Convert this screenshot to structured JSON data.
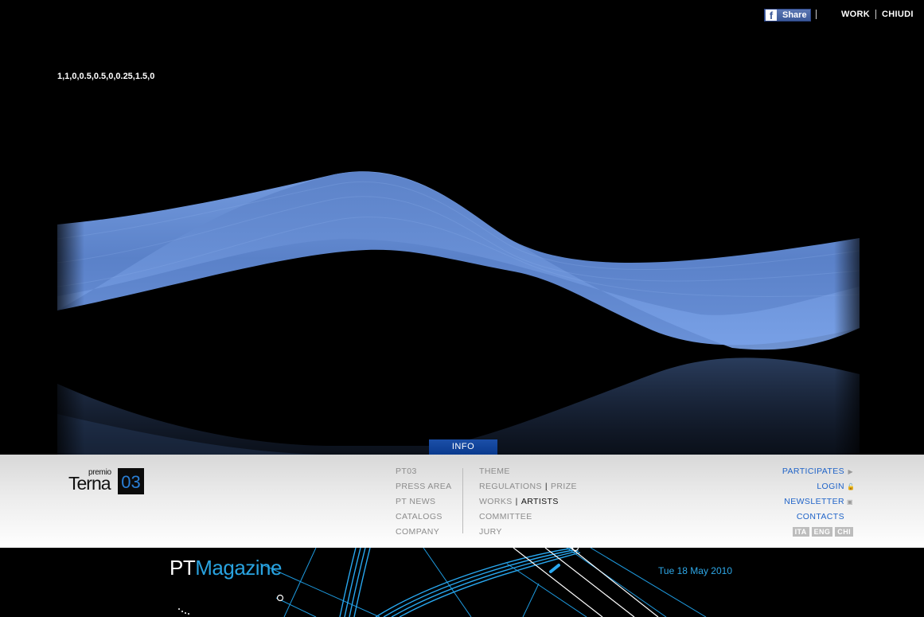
{
  "topbar": {
    "share_label": "Share",
    "fb_glyph": "f",
    "work_label": "WORK",
    "close_label": "CHIUDI"
  },
  "artwork": {
    "params_text": "1,1,0,0.5,0.5,0,0.25,1.5,0",
    "ribbon_color": "#6a92d8"
  },
  "info_tab": {
    "label": "INFO"
  },
  "logo": {
    "premio": "premio",
    "terna": "Terna",
    "number": "03"
  },
  "nav": {
    "col1": [
      "PT03",
      "PRESS AREA",
      "PT NEWS",
      "CATALOGS",
      "COMPANY"
    ],
    "col2": {
      "theme": "THEME",
      "regulations": "REGULATIONS",
      "prize": "PRIZE",
      "works": "WORKS",
      "artists": "ARTISTS",
      "committee": "COMMITTEE",
      "jury": "JURY"
    },
    "right": {
      "participates": "PARTICIPATES",
      "login": "LOGIN",
      "newsletter": "NEWSLETTER",
      "contacts": "CONTACTS",
      "languages": [
        "ITA",
        "ENG",
        "CHI"
      ]
    }
  },
  "magazine": {
    "title_pt": "PT",
    "title_magazine": "Magazine",
    "date": "Tue 18 May 2010"
  },
  "colors": {
    "accent_blue": "#1f63c8",
    "magazine_blue": "#29a3e0",
    "info_tab": "#0a3a8e"
  }
}
